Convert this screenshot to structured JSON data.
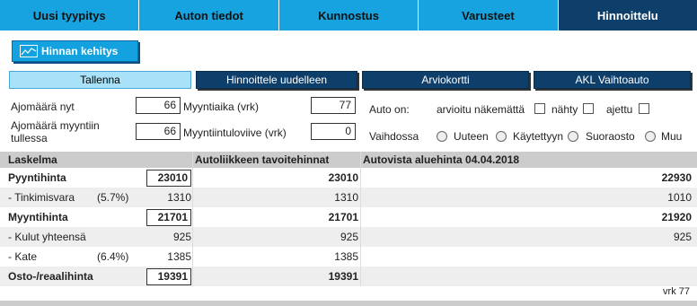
{
  "tabs": [
    "Uusi tyypitys",
    "Auton tiedot",
    "Kunnostus",
    "Varusteet",
    "Hinnoittelu"
  ],
  "hinnan_kehitys": "Hinnan kehitys",
  "actions": {
    "tallenna": "Tallenna",
    "hinnoittele": "Hinnoittele uudelleen",
    "arviokortti": "Arviokortti",
    "akl": "AKL Vaihtoauto"
  },
  "form": {
    "ajomaara_nyt_label": "Ajomäärä nyt",
    "ajomaara_nyt_value": "66",
    "myyntiaika_label": "Myyntiaika (vrk)",
    "myyntiaika_value": "77",
    "ajomaara_myynti_label_1": "Ajomäärä myyntiin",
    "ajomaara_myynti_label_2": "tullessa",
    "ajomaara_myynti_value": "66",
    "myyntiintuloviive_label": "Myyntiintuloviive (vrk)",
    "myyntiintuloviive_value": "0",
    "auto_on_label": "Auto on:",
    "arvioitu_label": "arvioitu näkemättä",
    "nahty_label": "nähty",
    "ajettu_label": "ajettu",
    "vaihdossa_label": "Vaihdossa",
    "radio_options": [
      "Uuteen",
      "Käytettyyn",
      "Suoraosto",
      "Muu"
    ]
  },
  "table": {
    "headers": {
      "laskelma": "Laskelma",
      "tavoite": "Autoliikkeen tavoitehinnat",
      "aluehinta": "Autovista aluehinta 04.04.2018"
    },
    "rows": [
      {
        "label": "Pyyntihinta",
        "pct": "",
        "input": "23010",
        "tavoite": "23010",
        "alue": "22930"
      },
      {
        "label": "- Tinkimisvara",
        "pct": "(5.7%)",
        "input": "1310",
        "tavoite": "1310",
        "alue": "1010"
      },
      {
        "label": "Myyntihinta",
        "pct": "",
        "input": "21701",
        "tavoite": "21701",
        "alue": "21920"
      },
      {
        "label": "- Kulut yhteensä",
        "pct": "",
        "input": "925",
        "tavoite": "925",
        "alue": "925"
      },
      {
        "label": "- Kate",
        "pct": "(6.4%)",
        "input": "1385",
        "tavoite": "1385",
        "alue": ""
      },
      {
        "label": "Osto-/reaalihinta",
        "pct": "",
        "input": "19391",
        "tavoite": "19391",
        "alue": ""
      }
    ],
    "footer_vrk": "vrk 77"
  }
}
